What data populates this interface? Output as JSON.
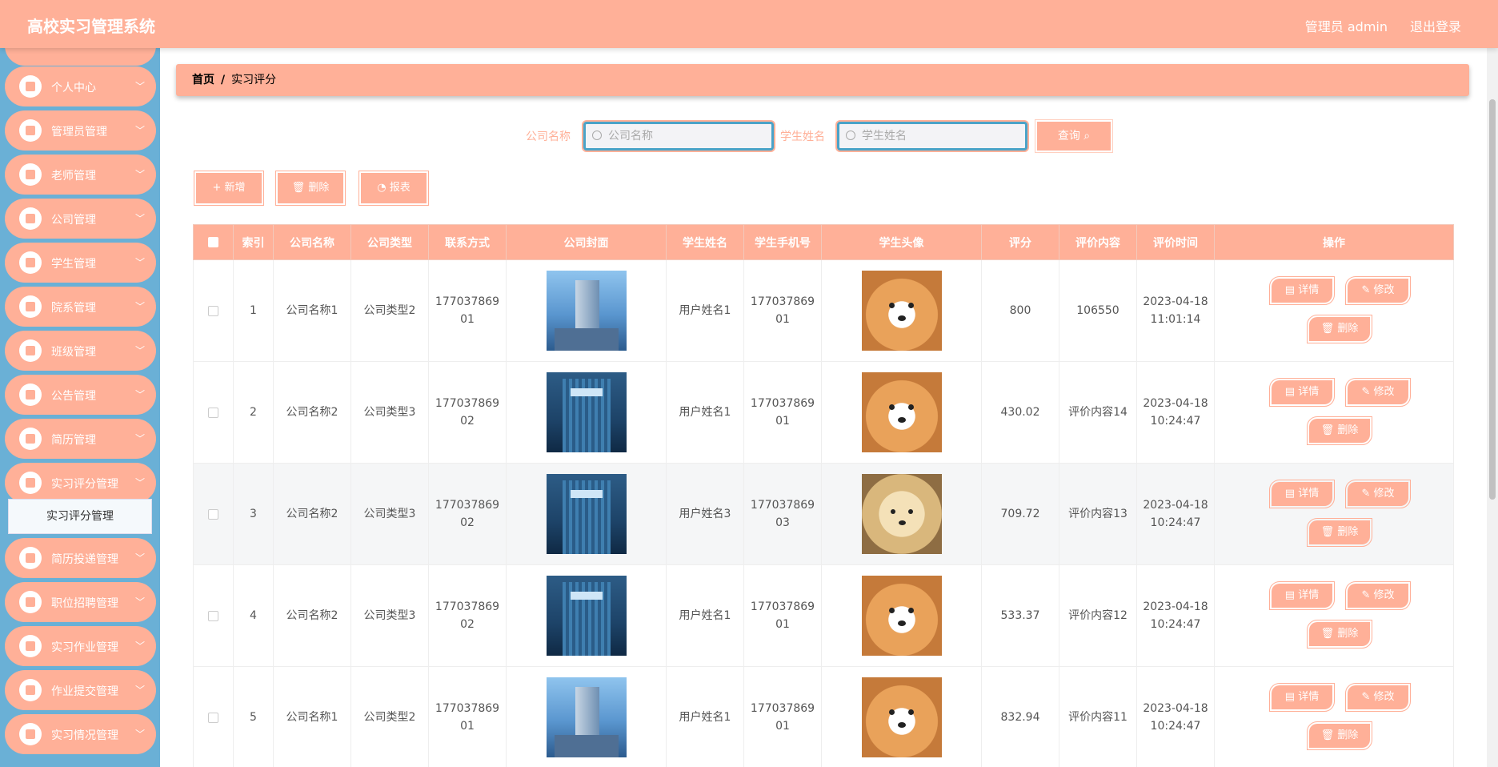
{
  "header": {
    "app_title": "高校实习管理系统",
    "admin": "管理员 admin",
    "logout": "退出登录"
  },
  "sidebar": {
    "items": [
      {
        "label": "个人中心"
      },
      {
        "label": "管理员管理"
      },
      {
        "label": "老师管理"
      },
      {
        "label": "公司管理"
      },
      {
        "label": "学生管理"
      },
      {
        "label": "院系管理"
      },
      {
        "label": "班级管理"
      },
      {
        "label": "公告管理"
      },
      {
        "label": "简历管理"
      },
      {
        "label": "实习评分管理"
      },
      {
        "label": "简历投递管理"
      },
      {
        "label": "职位招聘管理"
      },
      {
        "label": "实习作业管理"
      },
      {
        "label": "作业提交管理"
      },
      {
        "label": "实习情况管理"
      }
    ],
    "submenu_active": "实习评分管理"
  },
  "breadcrumb": {
    "home": "首页",
    "sep": "/",
    "current": "实习评分"
  },
  "search": {
    "company_label": "公司名称",
    "company_placeholder": "公司名称",
    "student_label": "学生姓名",
    "student_placeholder": "学生姓名",
    "query": "查询"
  },
  "actions": {
    "add": "+ 新增",
    "delete": "删除",
    "report": "报表"
  },
  "table": {
    "headers": [
      "索引",
      "公司名称",
      "公司类型",
      "联系方式",
      "公司封面",
      "学生姓名",
      "学生手机号",
      "学生头像",
      "评分",
      "评价内容",
      "评价时间",
      "操作"
    ],
    "rows": [
      {
        "index": "1",
        "company": "公司名称1",
        "type": "公司类型2",
        "contact": "17703786901",
        "cover": "v1",
        "student": "用户姓名1",
        "phone": "17703786901",
        "avatar": "shiba",
        "score": "800",
        "content": "106550",
        "time": "2023-04-18 11:01:14"
      },
      {
        "index": "2",
        "company": "公司名称2",
        "type": "公司类型3",
        "contact": "17703786902",
        "cover": "v2",
        "student": "用户姓名1",
        "phone": "17703786901",
        "avatar": "shiba",
        "score": "430.02",
        "content": "评价内容14",
        "time": "2023-04-18 10:24:47"
      },
      {
        "index": "3",
        "company": "公司名称2",
        "type": "公司类型3",
        "contact": "17703786902",
        "cover": "v2",
        "student": "用户姓名3",
        "phone": "17703786903",
        "avatar": "puppy",
        "score": "709.72",
        "content": "评价内容13",
        "time": "2023-04-18 10:24:47"
      },
      {
        "index": "4",
        "company": "公司名称2",
        "type": "公司类型3",
        "contact": "17703786902",
        "cover": "v2",
        "student": "用户姓名1",
        "phone": "17703786901",
        "avatar": "shiba",
        "score": "533.37",
        "content": "评价内容12",
        "time": "2023-04-18 10:24:47"
      },
      {
        "index": "5",
        "company": "公司名称1",
        "type": "公司类型2",
        "contact": "17703786901",
        "cover": "v1",
        "student": "用户姓名1",
        "phone": "17703786901",
        "avatar": "shiba",
        "score": "832.94",
        "content": "评价内容11",
        "time": "2023-04-18 10:24:47"
      }
    ],
    "ops": {
      "detail": "详情",
      "edit": "修改",
      "delete": "删除"
    }
  },
  "colors": {
    "accent": "#ffb098",
    "sidebar": "#6ab0d6",
    "input_border": "#4aa3c8"
  }
}
